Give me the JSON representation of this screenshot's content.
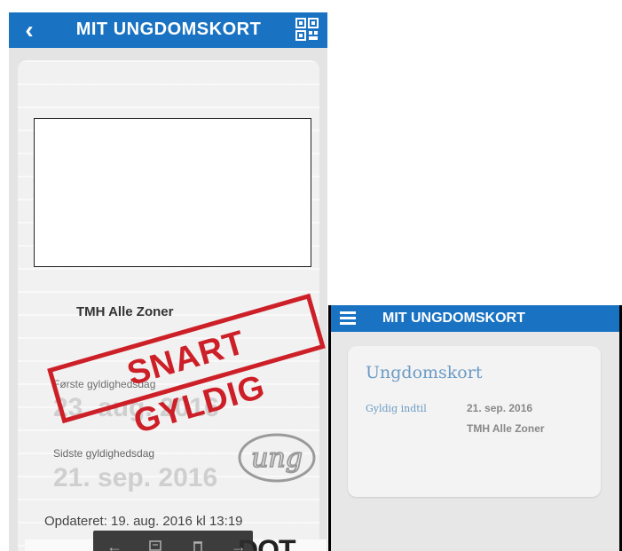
{
  "left_screen": {
    "header": {
      "title": "MIT UNGDOMSKORT",
      "back_icon": "chevron-left-icon",
      "qr_icon": "qr-code-icon"
    },
    "card": {
      "zone": "TMH Alle Zoner",
      "stamp": "SNART GYLDIG",
      "first_valid_label": "Første gyldighedsdag",
      "first_valid_value": "23. aug. 2016",
      "last_valid_label": "Sidste gyldighedsdag",
      "last_valid_value": "21. sep. 2016",
      "logo": "ung",
      "updated": "Opdateret: 19. aug. 2016 kl 13:19",
      "brand": "DOT"
    },
    "viewer_toolbar": [
      "arrow-left-icon",
      "comment-icon",
      "trash-icon",
      "arrow-right-icon"
    ],
    "colors": {
      "header": "#1a73c2",
      "stamp": "#cd1f27"
    }
  },
  "right_screen": {
    "header": {
      "title": "MIT UNGDOMSKORT",
      "menu_icon": "hamburger-menu-icon"
    },
    "card": {
      "title": "Ungdomskort",
      "valid_until_label": "Gyldig indtil",
      "valid_until_value": "21. sep. 2016",
      "zone": "TMH Alle Zoner"
    },
    "colors": {
      "accent": "#6b9bc4"
    }
  }
}
